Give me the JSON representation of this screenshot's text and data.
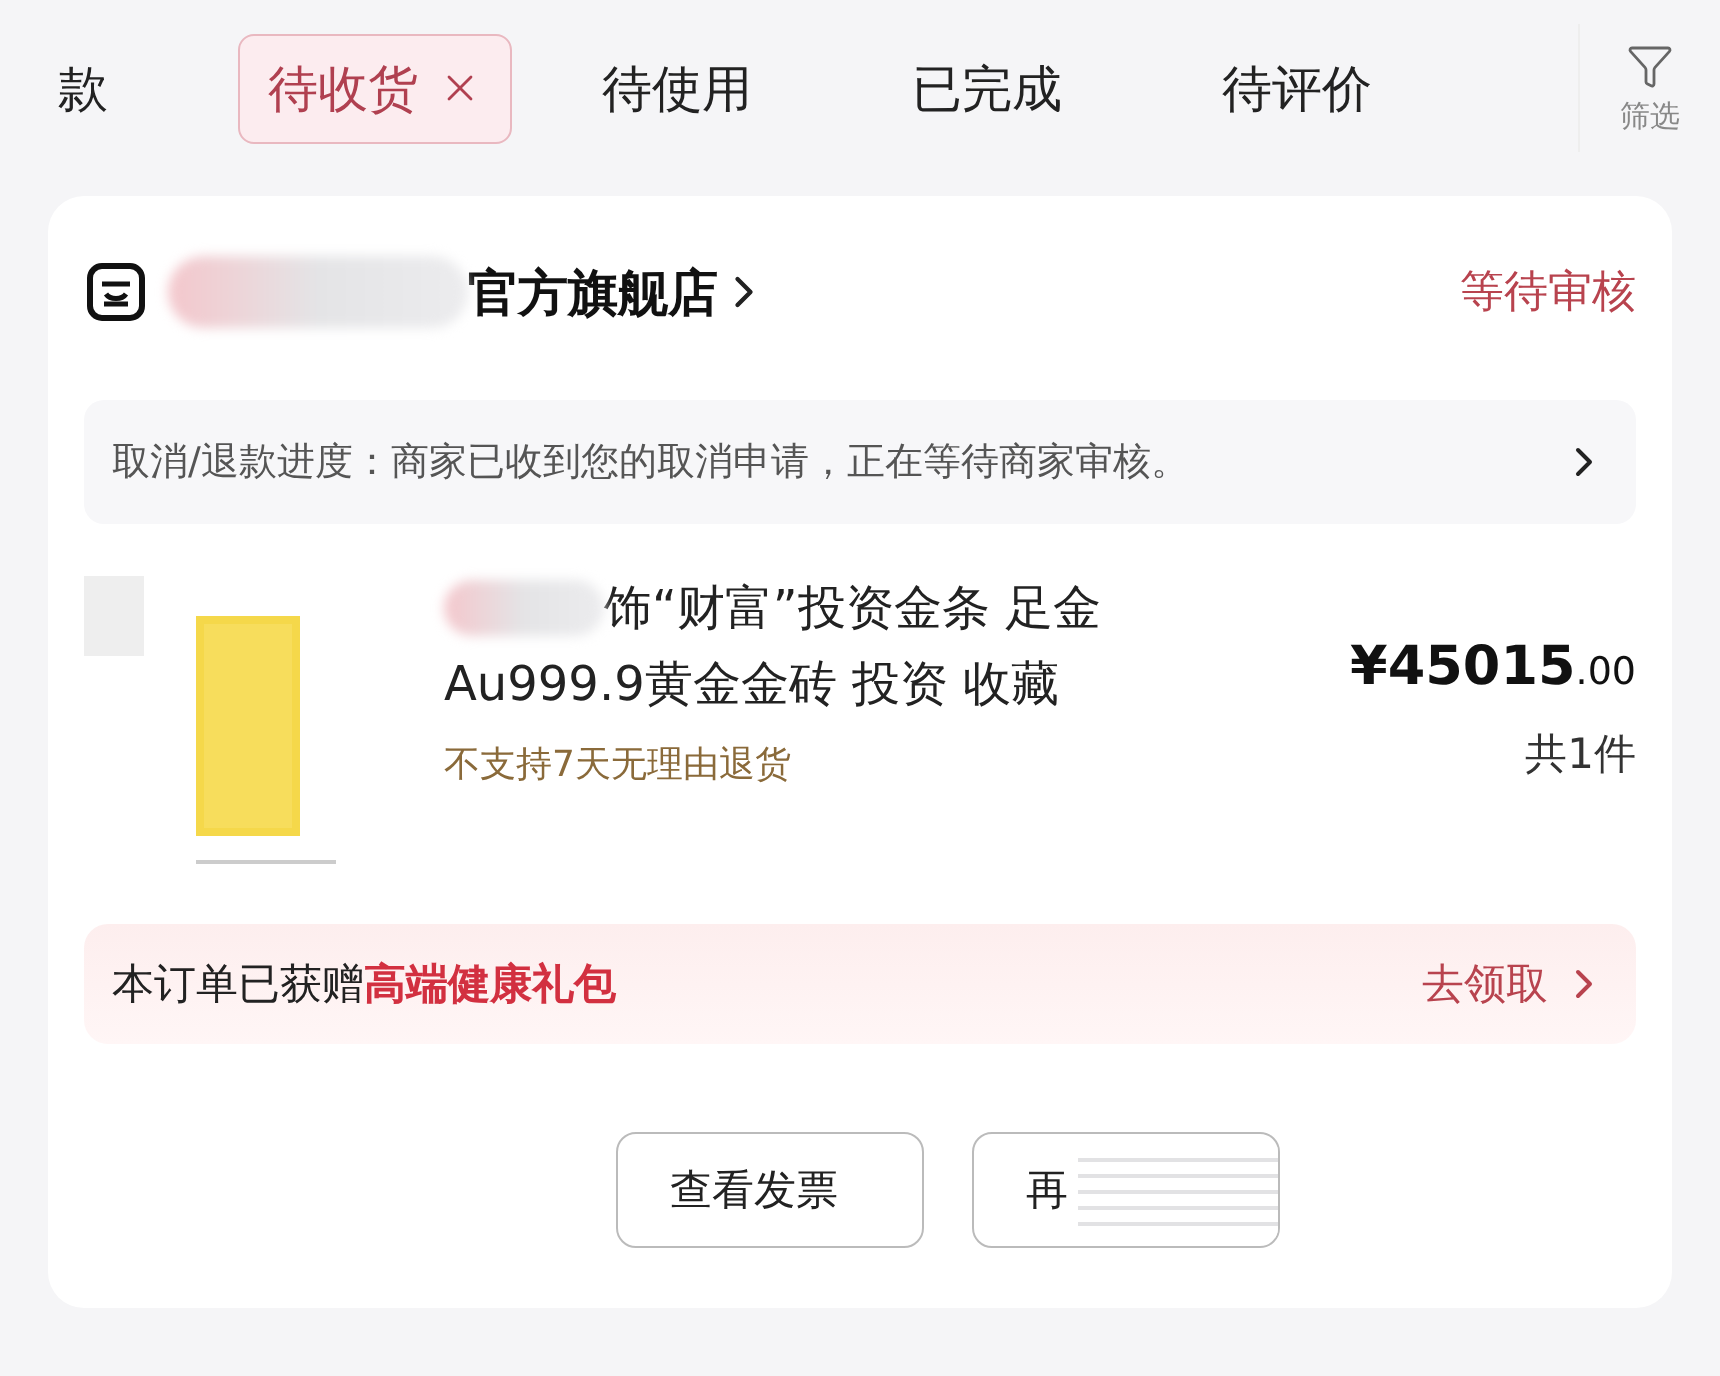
{
  "tabs": [
    {
      "label": "款",
      "selected": false,
      "closable": false
    },
    {
      "label": "待收货",
      "selected": true,
      "closable": true
    },
    {
      "label": "待使用",
      "selected": false,
      "closable": false
    },
    {
      "label": "已完成",
      "selected": false,
      "closable": false
    },
    {
      "label": "待评价",
      "selected": false,
      "closable": false
    }
  ],
  "filter": {
    "label": "筛选"
  },
  "order": {
    "store": {
      "name": "官方旗舰店",
      "redacted": true
    },
    "status": "等待审核",
    "progress": {
      "text": "取消/退款进度：商家已收到您的取消申请，正在等待商家审核。"
    },
    "product": {
      "redacted": true,
      "title_lines": [
        "饰“财富”投资金条 足金",
        "Au999.9黄金金砖 投资 收藏"
      ],
      "price": "¥45015",
      "price_cents": ".00",
      "quantity": "共1件",
      "note": "不支持7天无理由退货"
    },
    "gift": {
      "text": "本订单已获赠",
      "highlight": "高端健康礼包",
      "action": "去领取"
    },
    "buttons": [
      {
        "label": "查看发票",
        "obscured": false
      },
      {
        "label": "再",
        "obscured": true
      }
    ]
  }
}
